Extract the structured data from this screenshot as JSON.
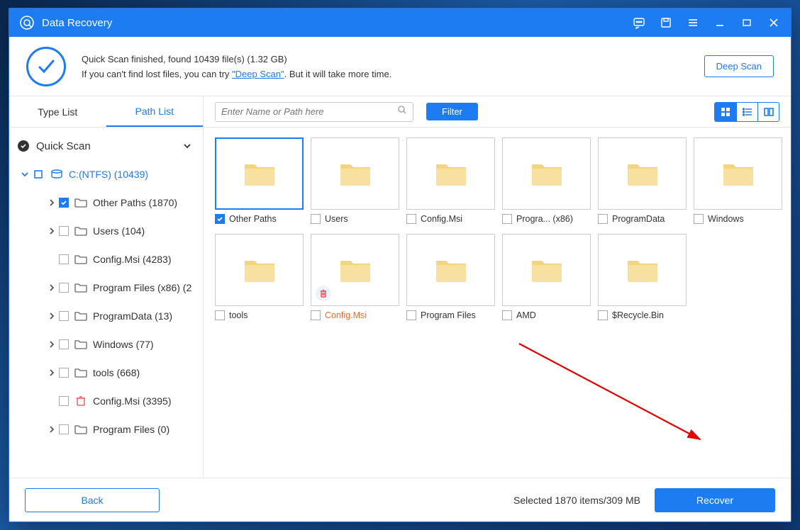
{
  "titlebar": {
    "app_name": "Data Recovery"
  },
  "summary": {
    "line1": "Quick Scan finished, found 10439 file(s) (1.32 GB)",
    "line2_pre": "If you can't find lost files, you can try ",
    "deep_link": "\"Deep Scan\"",
    "line2_post": ". But it will take more time.",
    "deep_btn": "Deep Scan"
  },
  "tabs": {
    "type": "Type List",
    "path": "Path List"
  },
  "tree": {
    "root": "Quick Scan",
    "drive": "C:(NTFS) (10439)",
    "items": [
      {
        "label": "Other Paths (1870)",
        "checked": true,
        "hasChildren": true
      },
      {
        "label": "Users (104)",
        "checked": false,
        "hasChildren": true
      },
      {
        "label": "Config.Msi (4283)",
        "checked": false,
        "hasChildren": false
      },
      {
        "label": "Program Files (x86) (2",
        "checked": false,
        "hasChildren": true
      },
      {
        "label": "ProgramData (13)",
        "checked": false,
        "hasChildren": true
      },
      {
        "label": "Windows (77)",
        "checked": false,
        "hasChildren": true
      },
      {
        "label": "tools (668)",
        "checked": false,
        "hasChildren": true
      },
      {
        "label": "Config.Msi (3395)",
        "checked": false,
        "hasChildren": false,
        "deleted": true
      },
      {
        "label": "Program Files (0)",
        "checked": false,
        "hasChildren": true
      }
    ]
  },
  "toolbar": {
    "search_placeholder": "Enter Name or Path here",
    "filter": "Filter"
  },
  "grid": [
    {
      "label": "Other Paths",
      "checked": true,
      "selected": true
    },
    {
      "label": "Users",
      "checked": false
    },
    {
      "label": "Config.Msi",
      "checked": false
    },
    {
      "label": "Progra... (x86)",
      "checked": false
    },
    {
      "label": "ProgramData",
      "checked": false
    },
    {
      "label": "Windows",
      "checked": false
    },
    {
      "label": "tools",
      "checked": false
    },
    {
      "label": "Config.Msi",
      "checked": false,
      "deleted": true
    },
    {
      "label": "Program Files",
      "checked": false
    },
    {
      "label": "AMD",
      "checked": false
    },
    {
      "label": "$Recycle.Bin",
      "checked": false
    }
  ],
  "footer": {
    "back": "Back",
    "status": "Selected 1870 items/309 MB",
    "recover": "Recover"
  }
}
